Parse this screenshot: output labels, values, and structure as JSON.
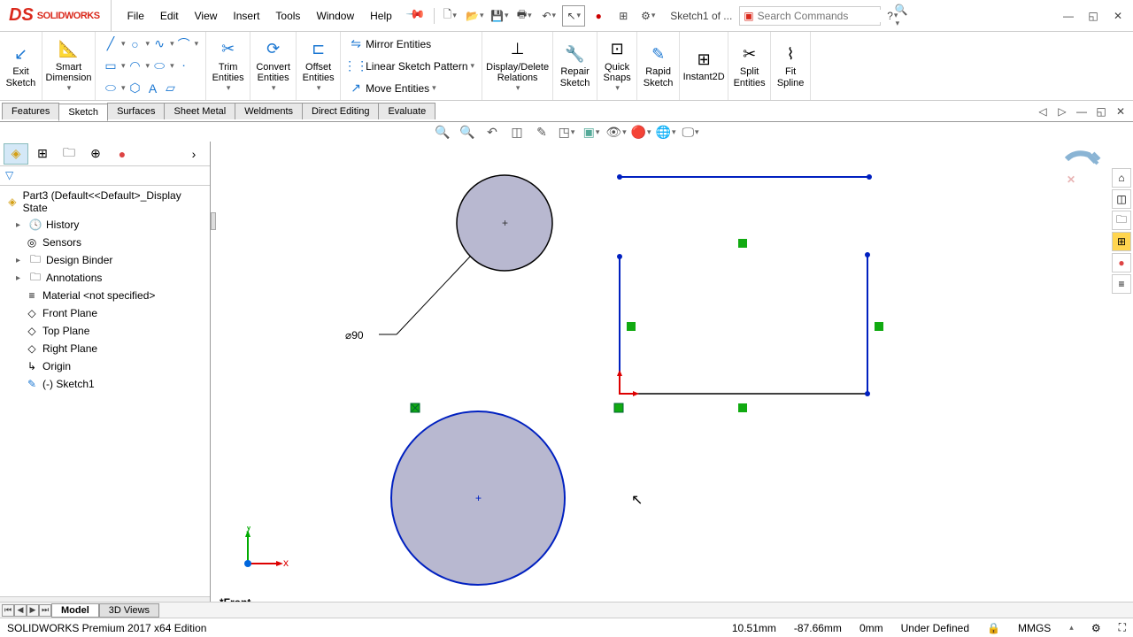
{
  "logo": {
    "ds": "DS",
    "text": "SOLIDWORKS"
  },
  "menu": {
    "file": "File",
    "edit": "Edit",
    "view": "View",
    "insert": "Insert",
    "tools": "Tools",
    "window": "Window",
    "help": "Help"
  },
  "doc_name": "Sketch1 of ...",
  "search_placeholder": "Search Commands",
  "ribbon": {
    "exit_sketch": "Exit\nSketch",
    "smart_dimension": "Smart\nDimension",
    "trim": "Trim\nEntities",
    "convert": "Convert\nEntities",
    "offset": "Offset\nEntities",
    "mirror": "Mirror Entities",
    "linear": "Linear Sketch Pattern",
    "move": "Move Entities",
    "display": "Display/Delete\nRelations",
    "repair": "Repair\nSketch",
    "quick": "Quick\nSnaps",
    "rapid": "Rapid\nSketch",
    "instant": "Instant2D",
    "split": "Split\nEntities",
    "fit": "Fit\nSpline"
  },
  "tabs": {
    "features": "Features",
    "sketch": "Sketch",
    "surfaces": "Surfaces",
    "sheet": "Sheet Metal",
    "weld": "Weldments",
    "direct": "Direct Editing",
    "eval": "Evaluate"
  },
  "tree": {
    "root": "Part3  (Default<<Default>_Display State",
    "history": "History",
    "sensors": "Sensors",
    "design_binder": "Design Binder",
    "annotations": "Annotations",
    "material": "Material <not specified>",
    "front_plane": "Front Plane",
    "top_plane": "Top Plane",
    "right_plane": "Right Plane",
    "origin": "Origin",
    "sketch1": "(-) Sketch1"
  },
  "dimension": "⌀90",
  "view_name": "*Front",
  "bottom": {
    "model": "Model",
    "views3d": "3D Views"
  },
  "status": {
    "edition": "SOLIDWORKS Premium 2017 x64 Edition",
    "x": "10.51mm",
    "y": "-87.66mm",
    "z": "0mm",
    "state": "Under Defined",
    "units": "MMGS"
  },
  "triad": {
    "x": "x",
    "y": "y"
  }
}
